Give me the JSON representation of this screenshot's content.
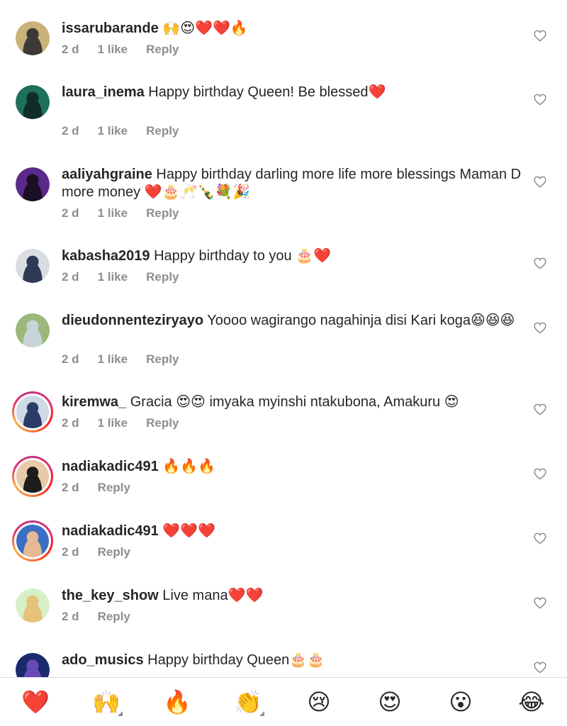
{
  "comments": [
    {
      "username": "issarubarande",
      "text": " 🙌😍❤️❤️🔥",
      "time": "2 d",
      "likes": "1 like",
      "reply": "Reply",
      "avatar_colors": [
        "#c9b27a",
        "#3b3a36"
      ],
      "story": false
    },
    {
      "username": "laura_inema",
      "text": " Happy birthday Queen! Be blessed❤️",
      "time": "2 d",
      "likes": "1 like",
      "reply": "Reply",
      "avatar_colors": [
        "#1f6f5d",
        "#0f2e29"
      ],
      "story": false
    },
    {
      "username": "aaliyahgraine",
      "text": " Happy birthday darling more life more blessings Maman D more money ❤️🎂🥂🍾💐🎉",
      "time": "2 d",
      "likes": "1 like",
      "reply": "Reply",
      "avatar_colors": [
        "#5a2a8a",
        "#1a0f24"
      ],
      "story": false
    },
    {
      "username": "kabasha2019",
      "text": " Happy birthday to you 🎂❤️",
      "time": "2 d",
      "likes": "1 like",
      "reply": "Reply",
      "avatar_colors": [
        "#d9dde2",
        "#2c3a55"
      ],
      "story": false
    },
    {
      "username": "dieudonnenteziryayo",
      "text": " Yoooo wagirango nagahinja disi Kari koga😆😆😆",
      "time": "2 d",
      "likes": "1 like",
      "reply": "Reply",
      "avatar_colors": [
        "#9ab87a",
        "#c7d4d9"
      ],
      "story": false
    },
    {
      "username": "kiremwa_",
      "text": " Gracia 😍😍 imyaka myinshi ntakubona, Amakuru 😍",
      "time": "2 d",
      "likes": "1 like",
      "reply": "Reply",
      "avatar_colors": [
        "#cfd9e6",
        "#2a3b66"
      ],
      "story": true
    },
    {
      "username": "nadiakadic491",
      "text": " 🔥🔥🔥",
      "time": "2 d",
      "likes": "",
      "reply": "Reply",
      "avatar_colors": [
        "#e8c9a8",
        "#1c1c1c"
      ],
      "story": true
    },
    {
      "username": "nadiakadic491",
      "text": " ❤️❤️❤️",
      "time": "2 d",
      "likes": "",
      "reply": "Reply",
      "avatar_colors": [
        "#3a6fc4",
        "#e6b894"
      ],
      "story": true
    },
    {
      "username": "the_key_show",
      "text": " Live mana❤️❤️",
      "time": "2 d",
      "likes": "",
      "reply": "Reply",
      "avatar_colors": [
        "#d8f0c8",
        "#e6c27a"
      ],
      "story": false
    },
    {
      "username": "ado_musics",
      "text": " Happy birthday Queen🎂🎂",
      "time": "",
      "likes": "",
      "reply": "",
      "avatar_colors": [
        "#1b2a6b",
        "#6a4ab8"
      ],
      "story": false
    }
  ],
  "emoji_tray": [
    {
      "emoji": "❤️",
      "name": "heart",
      "has_variants": false
    },
    {
      "emoji": "🙌",
      "name": "raising-hands",
      "has_variants": true
    },
    {
      "emoji": "🔥",
      "name": "fire",
      "has_variants": false
    },
    {
      "emoji": "👏",
      "name": "clapping-hands",
      "has_variants": true
    },
    {
      "emoji": "😢",
      "name": "crying-face",
      "has_variants": false
    },
    {
      "emoji": "😍",
      "name": "heart-eyes",
      "has_variants": false
    },
    {
      "emoji": "😮",
      "name": "surprised-face",
      "has_variants": false
    },
    {
      "emoji": "😂",
      "name": "tears-of-joy",
      "has_variants": false
    }
  ],
  "colors": {
    "text": "#262626",
    "meta": "#8e8e8e",
    "divider": "#dbdbdb",
    "heart_outline": "#8e8e8e"
  },
  "icons": {
    "like": "heart-outline-icon"
  }
}
